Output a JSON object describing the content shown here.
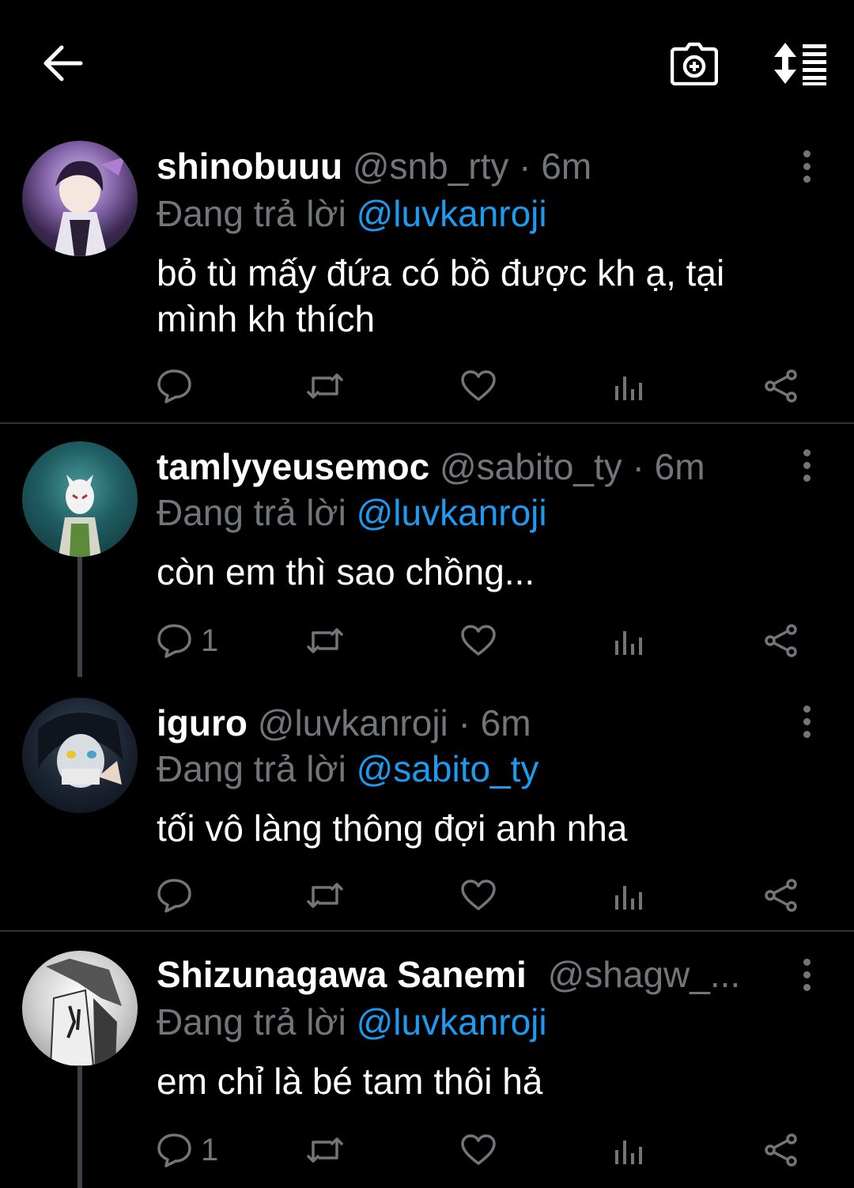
{
  "header": {
    "back_icon": "arrow-left-icon",
    "camera_icon": "camera-plus-icon",
    "sort_icon": "sort-list-icon"
  },
  "replying_prefix": "Đang trả lời",
  "tweets": [
    {
      "name": "shinobuuu",
      "handle": "@snb_rty",
      "time": "· 6m",
      "reply_to": "@luvkanroji",
      "text": "bỏ tù mấy đứa có bồ được kh ạ, tại mình kh thích",
      "reply_count": ""
    },
    {
      "name": "tamlyyeusemoc",
      "handle": "@sabito_ty",
      "time": "· 6m",
      "reply_to": "@luvkanroji",
      "text": "còn em thì sao chồng...",
      "reply_count": "1"
    },
    {
      "name": "iguro",
      "handle": "@luvkanroji",
      "time": "· 6m",
      "reply_to": "@sabito_ty",
      "text": "tối vô làng thông đợi anh nha",
      "reply_count": ""
    },
    {
      "name": "Shizunagawa Sanemi",
      "handle": "@shagw_...",
      "time": "",
      "reply_to": "@luvkanroji",
      "text": "em chỉ là bé tam thôi hả",
      "reply_count": "1"
    }
  ],
  "colors": {
    "background": "#000000",
    "text": "#ffffff",
    "muted": "#71767b",
    "link": "#1d9bf0",
    "divider": "#2f3336"
  }
}
